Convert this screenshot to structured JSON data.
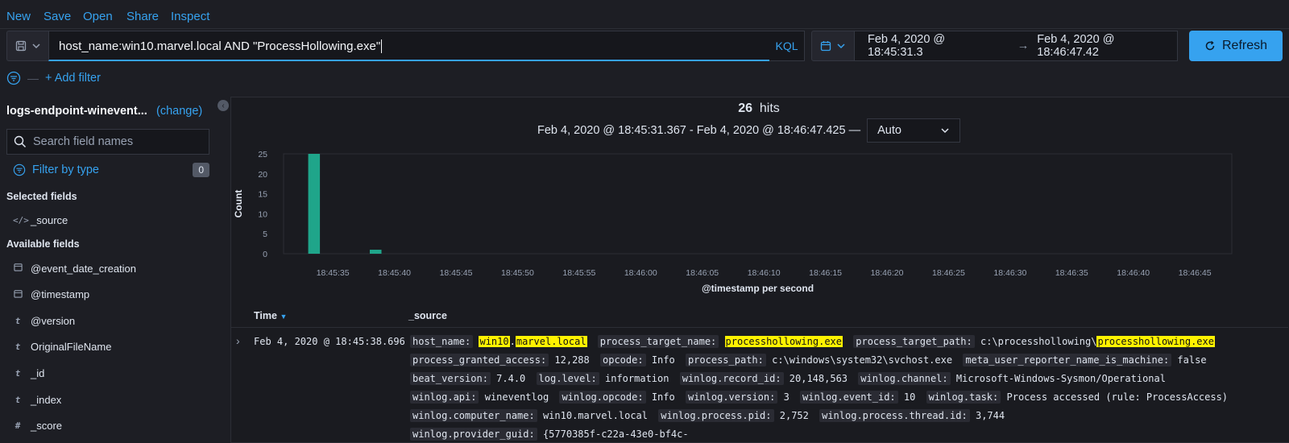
{
  "topnav": {
    "new": "New",
    "save": "Save",
    "open": "Open",
    "share": "Share",
    "inspect": "Inspect"
  },
  "query": {
    "text": "host_name:win10.marvel.local AND \"ProcessHollowing.exe\"",
    "language": "KQL"
  },
  "datepicker": {
    "start": "Feb 4, 2020 @ 18:45:31.3",
    "end": "Feb 4, 2020 @ 18:46:47.42",
    "arrow": "→"
  },
  "refresh_label": "Refresh",
  "add_filter": "+ Add filter",
  "sidebar": {
    "index_pattern": "logs-endpoint-winevent...",
    "change": "(change)",
    "search_placeholder": "Search field names",
    "filter_by_type": "Filter by type",
    "filter_count": "0",
    "selected_label": "Selected fields",
    "selected_fields": [
      {
        "icon": "</>",
        "name": "_source"
      }
    ],
    "available_label": "Available fields",
    "available_fields": [
      {
        "icon": "cal",
        "name": "@event_date_creation"
      },
      {
        "icon": "cal",
        "name": "@timestamp"
      },
      {
        "icon": "t",
        "name": "@version"
      },
      {
        "icon": "t",
        "name": "OriginalFileName"
      },
      {
        "icon": "t",
        "name": "_id"
      },
      {
        "icon": "t",
        "name": "_index"
      },
      {
        "icon": "#",
        "name": "_score"
      }
    ]
  },
  "results": {
    "hits_count": "26",
    "hits_label": "hits",
    "time_range": "Feb 4, 2020 @ 18:45:31.367 - Feb 4, 2020 @ 18:46:47.425 —",
    "interval": "Auto"
  },
  "chart_data": {
    "type": "bar",
    "ylabel": "Count",
    "xlabel": "@timestamp per second",
    "ylim": [
      0,
      25
    ],
    "yticks": [
      0,
      5,
      10,
      15,
      20,
      25
    ],
    "xticks": [
      "18:45:35",
      "18:45:40",
      "18:45:45",
      "18:45:50",
      "18:45:55",
      "18:46:00",
      "18:46:05",
      "18:46:10",
      "18:46:15",
      "18:46:20",
      "18:46:25",
      "18:46:30",
      "18:46:35",
      "18:46:40",
      "18:46:45"
    ],
    "x_start_seconds": 31,
    "x_end_seconds": 48,
    "bars": [
      {
        "time": "18:45:33",
        "value": 25
      },
      {
        "time": "18:45:38",
        "value": 1
      }
    ],
    "color": "#1fa58a",
    "grid": false
  },
  "table": {
    "time_header": "Time",
    "source_header": "_source",
    "rows": [
      {
        "time": "Feb 4, 2020 @ 18:45:38.696",
        "source": [
          {
            "k": "host_name:",
            "v": [
              {
                "t": "win10",
                "h": true
              },
              {
                "t": ".",
                "h": false
              },
              {
                "t": "marvel.local",
                "h": true
              }
            ]
          },
          {
            "k": "process_target_name:",
            "v": [
              {
                "t": "processhollowing.exe",
                "h": true
              }
            ]
          },
          {
            "k": "process_target_path:",
            "v": [
              {
                "t": "c:\\processhollowing\\",
                "h": false
              },
              {
                "t": "processhollowing.exe",
                "h": true
              }
            ]
          },
          {
            "k": "process_granted_access:",
            "v": [
              {
                "t": "12,288",
                "h": false
              }
            ]
          },
          {
            "k": "opcode:",
            "v": [
              {
                "t": "Info",
                "h": false
              }
            ]
          },
          {
            "k": "process_path:",
            "v": [
              {
                "t": "c:\\windows\\system32\\svchost.exe",
                "h": false
              }
            ]
          },
          {
            "k": "meta_user_reporter_name_is_machine:",
            "v": [
              {
                "t": "false",
                "h": false
              }
            ]
          },
          {
            "k": "beat_version:",
            "v": [
              {
                "t": "7.4.0",
                "h": false
              }
            ]
          },
          {
            "k": "log.level:",
            "v": [
              {
                "t": "information",
                "h": false
              }
            ]
          },
          {
            "k": "winlog.record_id:",
            "v": [
              {
                "t": "20,148,563",
                "h": false
              }
            ]
          },
          {
            "k": "winlog.channel:",
            "v": [
              {
                "t": "Microsoft-Windows-Sysmon/Operational",
                "h": false
              }
            ]
          },
          {
            "k": "winlog.api:",
            "v": [
              {
                "t": "wineventlog",
                "h": false
              }
            ]
          },
          {
            "k": "winlog.opcode:",
            "v": [
              {
                "t": "Info",
                "h": false
              }
            ]
          },
          {
            "k": "winlog.version:",
            "v": [
              {
                "t": "3",
                "h": false
              }
            ]
          },
          {
            "k": "winlog.event_id:",
            "v": [
              {
                "t": "10",
                "h": false
              }
            ]
          },
          {
            "k": "winlog.task:",
            "v": [
              {
                "t": "Process accessed (rule: ProcessAccess)",
                "h": false
              }
            ]
          },
          {
            "k": "winlog.computer_name:",
            "v": [
              {
                "t": "win10.marvel.local",
                "h": false
              }
            ]
          },
          {
            "k": "winlog.process.pid:",
            "v": [
              {
                "t": "2,752",
                "h": false
              }
            ]
          },
          {
            "k": "winlog.process.thread.id:",
            "v": [
              {
                "t": "3,744",
                "h": false
              }
            ]
          },
          {
            "k": "winlog.provider_guid:",
            "v": [
              {
                "t": "{5770385f-c22a-43e0-bf4c-",
                "h": false
              }
            ]
          }
        ]
      }
    ]
  }
}
